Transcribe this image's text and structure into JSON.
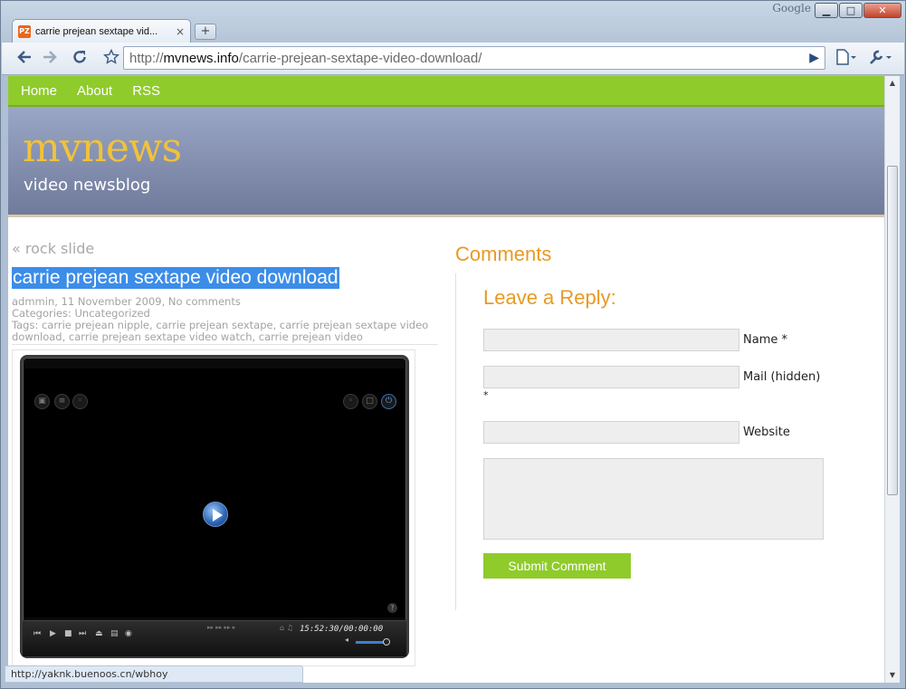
{
  "window": {
    "search_brand": "Google",
    "minimize": "▁",
    "maximize": "□",
    "close": "✕"
  },
  "tab": {
    "favicon_text": "PZ",
    "title": "carrie prejean sextape vid...",
    "close": "×",
    "new_tab": "+"
  },
  "toolbar": {
    "back_icon": "arrow-left-icon",
    "forward_icon": "arrow-right-icon",
    "reload_icon": "reload-icon",
    "bookmark_icon": "star-icon",
    "url_scheme": "http://",
    "url_host": "mvnews.info",
    "url_path": "/carrie-prejean-sextape-video-download/",
    "go": "▶",
    "page_menu": "▤▾",
    "tools_menu": "🔧▾"
  },
  "site": {
    "nav": [
      "Home",
      "About",
      "RSS"
    ],
    "title": "mvnews",
    "tagline": "video newsblog"
  },
  "post": {
    "prev_link": "« rock slide",
    "title": "carrie prejean sextape video download",
    "byline": "admmin, 11 November 2009, No comments",
    "categories": "Categories: Uncategorized",
    "tags_line1": "Tags: carrie prejean nipple, carrie prejean sextape, carrie prejean sextape video",
    "tags_line2": "download, carrie prejean sextape video watch, carrie prejean video"
  },
  "player": {
    "time": "15:52:30/00:00:00",
    "help": "?",
    "seek_controls": "▸▸ ▸▸ ▸▸ ▸",
    "volume_level": 0.8
  },
  "comments": {
    "heading": "Comments",
    "reply_heading": "Leave a Reply:",
    "name_label": "Name *",
    "mail_label": "Mail (hidden)",
    "mail_required": "*",
    "website_label": "Website",
    "submit": "Submit Comment"
  },
  "status": {
    "hover_url": "http://yaknk.buenoos.cn/wbhoy"
  },
  "colors": {
    "nav_green": "#8fcb2b",
    "accent_orange": "#e89a23",
    "title_gold": "#f1c23a",
    "selection_blue": "#3c8de8"
  }
}
